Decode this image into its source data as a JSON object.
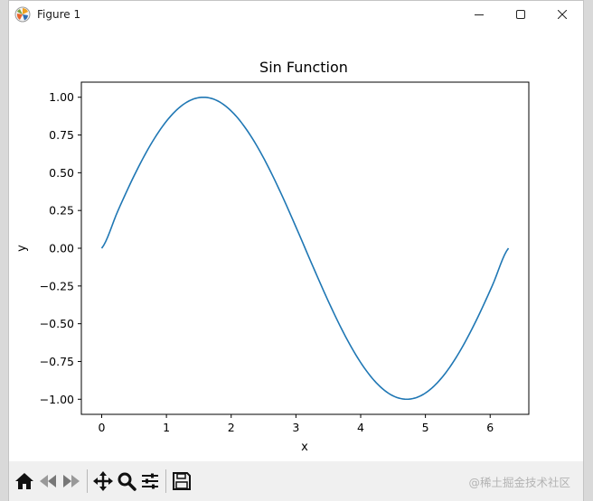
{
  "window": {
    "title": "Figure 1",
    "controls": [
      "minimize",
      "maximize",
      "close"
    ]
  },
  "toolbar": {
    "buttons": [
      {
        "name": "home-icon"
      },
      {
        "name": "back-icon"
      },
      {
        "name": "forward-icon"
      },
      {
        "name": "pan-icon"
      },
      {
        "name": "zoom-icon"
      },
      {
        "name": "configure-subplots-icon"
      },
      {
        "name": "save-icon"
      }
    ],
    "watermark": "@稀土掘金技术社区"
  },
  "chart_data": {
    "type": "line",
    "title": "Sin Function",
    "xlabel": "x",
    "ylabel": "y",
    "xlim": [
      -0.314,
      6.597
    ],
    "ylim": [
      -1.1,
      1.1
    ],
    "xticks": [
      0,
      1,
      2,
      3,
      4,
      5,
      6
    ],
    "yticks": [
      -1.0,
      -0.75,
      -0.5,
      -0.25,
      0.0,
      0.25,
      0.5,
      0.75,
      1.0
    ],
    "ytick_labels": [
      "−1.00",
      "−0.75",
      "−0.50",
      "−0.25",
      "0.00",
      "0.25",
      "0.50",
      "0.75",
      "1.00"
    ],
    "grid": false,
    "series": [
      {
        "color": "#1f77b4",
        "x": [
          0,
          0.2513,
          0.5027,
          0.754,
          1.0053,
          1.2566,
          1.508,
          1.7593,
          2.0106,
          2.2619,
          2.5133,
          2.7646,
          3.0159,
          3.2673,
          3.5186,
          3.7699,
          4.0212,
          4.2726,
          4.5239,
          4.7752,
          5.0265,
          5.2779,
          5.5292,
          5.7805,
          6.0319,
          6.2832
        ],
        "y": [
          0,
          0.2487,
          0.4818,
          0.6845,
          0.8443,
          0.9511,
          0.998,
          0.9823,
          0.9048,
          0.7705,
          0.5878,
          0.3681,
          0.1253,
          -0.1253,
          -0.3681,
          -0.5878,
          -0.7705,
          -0.9048,
          -0.9823,
          -0.998,
          -0.9511,
          -0.8443,
          -0.6845,
          -0.4818,
          -0.2487,
          0
        ]
      }
    ]
  }
}
